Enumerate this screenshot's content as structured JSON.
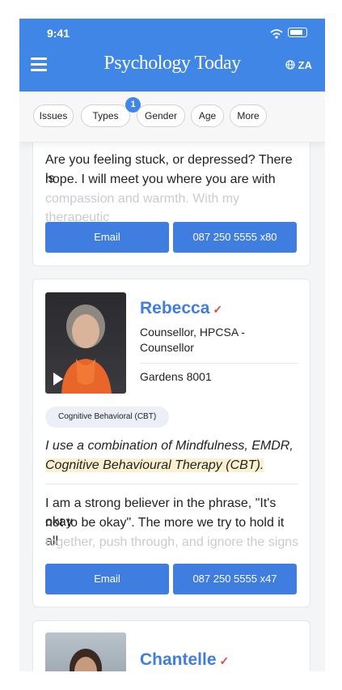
{
  "status": {
    "time": "9:41"
  },
  "header": {
    "brand": "Psychology Today",
    "region": "ZA"
  },
  "filters": {
    "issues": "Issues",
    "types": "Types",
    "types_badge": "1",
    "gender": "Gender",
    "age": "Age",
    "more": "More"
  },
  "cards": [
    {
      "snippet_1": "Are you feeling stuck, or depressed? There is",
      "snippet_2": "hope. I will meet you where you are with",
      "snippet_3": "compassion and warmth. With my  therapeutic",
      "email": "Email",
      "phone": "087 250 5555 x80"
    },
    {
      "name": "Rebecca",
      "title": "Counsellor, HPCSA - Counsellor",
      "location": "Gardens 8001",
      "tag": "Cognitive Behavioral (CBT)",
      "quote_1": "I use a combination of Mindfulness,  EMDR, and",
      "quote_2": "Cognitive Behavioural Therapy (CBT).",
      "snippet_1": "I am a strong believer in the phrase, \"It's okay",
      "snippet_2": "not to be okay\". The more we try to hold it all",
      "snippet_3": "together, push through, and ignore the signs",
      "email": "Email",
      "phone": "087 250 5555 x47"
    },
    {
      "name": "Chantelle"
    }
  ],
  "icons": {
    "check": "verified-check-icon",
    "globe": "globe-icon",
    "menu": "hamburger-menu-icon",
    "play": "play-icon"
  }
}
